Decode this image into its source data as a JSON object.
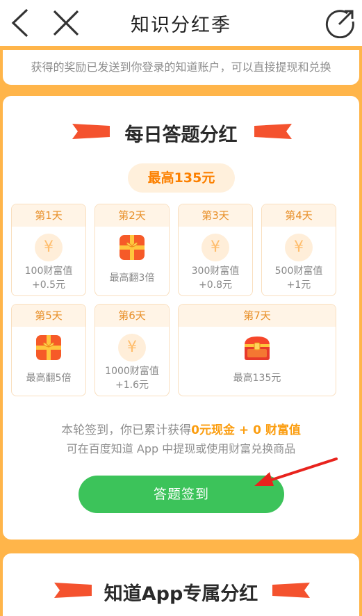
{
  "nav": {
    "title": "知识分红季",
    "icons": [
      "back-icon",
      "close-icon",
      "share-icon"
    ]
  },
  "notice": "获得的奖励已发送到你登录的知道账户，可以直接提现和兑换",
  "daily": {
    "title": "每日答题分红",
    "max_badge": "最高135元",
    "days": [
      {
        "label": "第1天",
        "icon": "coin-icon",
        "line1": "100财富值",
        "line2": "+0.5元"
      },
      {
        "label": "第2天",
        "icon": "gift-icon",
        "line1": "最高翻3倍",
        "line2": ""
      },
      {
        "label": "第3天",
        "icon": "coin-icon",
        "line1": "300财富值",
        "line2": "+0.8元"
      },
      {
        "label": "第4天",
        "icon": "coin-icon",
        "line1": "500财富值",
        "line2": "+1元"
      },
      {
        "label": "第5天",
        "icon": "gift-icon",
        "line1": "最高翻5倍",
        "line2": ""
      },
      {
        "label": "第6天",
        "icon": "coin-icon",
        "line1": "1000财富值",
        "line2": "+1.6元"
      },
      {
        "label": "第7天",
        "icon": "treasure-chest-icon",
        "line1": "最高135元",
        "line2": ""
      }
    ],
    "summary_prefix": "本轮签到，你已累计获得",
    "summary_cash": "0元现金",
    "summary_plus": " + ",
    "summary_wealth": "0 财富值",
    "summary_line2": "可在百度知道 App 中提现或使用财富兑换商品",
    "sign_button": "答题签到"
  },
  "app": {
    "title": "知道App专属分红"
  },
  "colors": {
    "background": "#ffb54a",
    "accent_orange": "#fc8000",
    "button_green": "#3cc35a",
    "ribbon_red": "#f4522e",
    "arrow_red": "#e8231d"
  }
}
